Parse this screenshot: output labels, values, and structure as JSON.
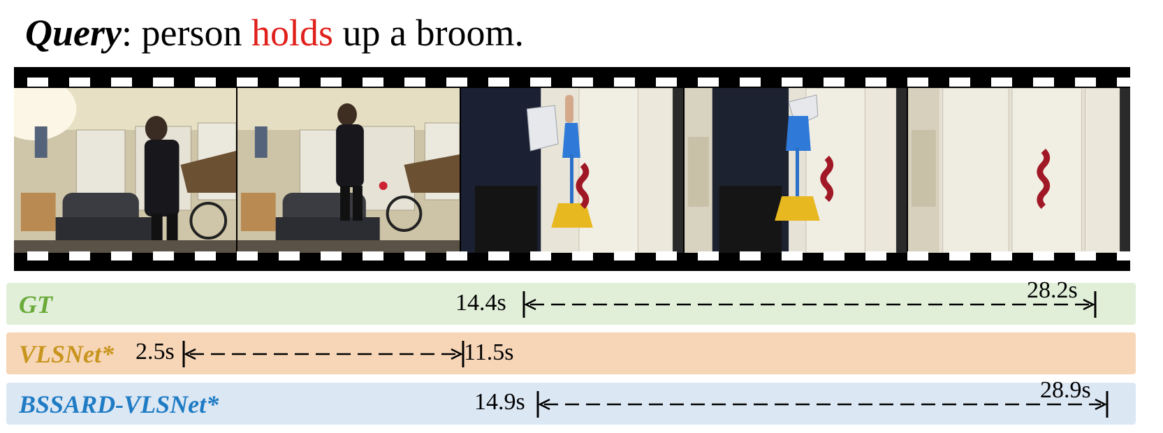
{
  "query": {
    "label": "Query",
    "separator": ": ",
    "before": "person ",
    "keyword": "holds",
    "after": " up a broom."
  },
  "colors": {
    "keyword": "#e0201b",
    "gt": "#6aaa3a",
    "vls": "#c8951e",
    "bssard": "#1f7cc4",
    "gt_bg": "#e1efd9",
    "vls_bg": "#f7d6b8",
    "bssard_bg": "#dce7f4"
  },
  "frames": [
    "frame-1",
    "frame-2",
    "frame-3",
    "frame-4",
    "frame-5"
  ],
  "results": [
    {
      "id": "gt",
      "label": "GT",
      "start": "14.4s",
      "end": "28.2s"
    },
    {
      "id": "vls",
      "label": "VLSNet*",
      "start": "2.5s",
      "end": "11.5s"
    },
    {
      "id": "bssard",
      "label": "BSSARD-VLSNet*",
      "start": "14.9s",
      "end": "28.9s"
    }
  ]
}
